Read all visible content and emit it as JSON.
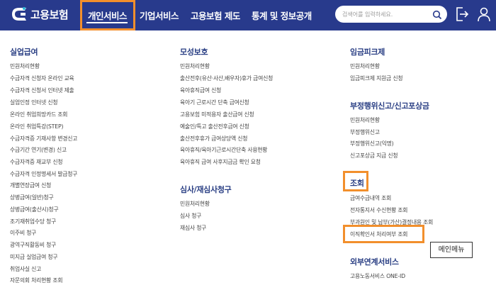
{
  "header": {
    "logo_text": "고용보험",
    "nav": [
      "개인서비스",
      "기업서비스",
      "고용보험 제도",
      "통계 및 정보공개"
    ],
    "search_placeholder": "검색어를 입력하세요.",
    "colors": {
      "bar": "#283a8c",
      "highlight": "#f28f2c"
    }
  },
  "col1": {
    "title": "실업급여",
    "items": [
      "민원처리현황",
      "수급자격 신청자 온라인 교육",
      "수급자격 신청서 인터넷 제출",
      "실업인정 인터넷 신청",
      "온라인 취업희망카드 조회",
      "온라인 취업특강(STEP)",
      "수급자격증 기재사항 변경신고",
      "수급기간 연기(변경) 신고",
      "수급자격증 재교부 신청",
      "수급자격 인정명세서 발급청구",
      "개별연장급여 신청",
      "상병급여(일반)청구",
      "상병급여(출산시)청구",
      "조기재취업수당 청구",
      "이주비 청구",
      "광역구직활동비 청구",
      "미지급 실업급여 청구",
      "취업사실 신고",
      "자문의회 처리현황 조회"
    ]
  },
  "col2": {
    "title1": "모성보호",
    "items1": [
      "민원처리현황",
      "출산전후(유산·사산,배우자)휴가 급여신청",
      "육아휴직급여 신청",
      "육아기 근로시간 단축 급여신청",
      "고용보험 미적용자 출산급여 신청",
      "예술인/특고 출산전후급여 신청",
      "출산전후휴가 급여상당액 신청",
      "육아휴직/육아기근로시간단축 사용현황",
      "육아휴직 급여 사후지급금 확인 요청"
    ],
    "title2": "심사/재심사청구",
    "items2": [
      "민원처리현황",
      "심사 청구",
      "재심사 청구"
    ]
  },
  "col3": {
    "title1": "임금피크제",
    "items1": [
      "민원처리현황",
      "임금피크제 지원금 신청"
    ],
    "title2": "부정행위신고/신고포상금",
    "items2": [
      "민원처리현황",
      "부정행위신고",
      "부정행위신고(익명)",
      "신고포상금 지급 신청"
    ],
    "title3": "조회",
    "items3": [
      "급여수급내역 조회",
      "전자통지서 수신현황 조회",
      "부과원인 및 납부(가산)결정내용 조회",
      "이직확인서 처리여부 조회"
    ],
    "title4": "외부연계서비스",
    "items4": [
      "고용노동서비스 ONE-ID"
    ]
  },
  "tooltip": "메인메뉴"
}
